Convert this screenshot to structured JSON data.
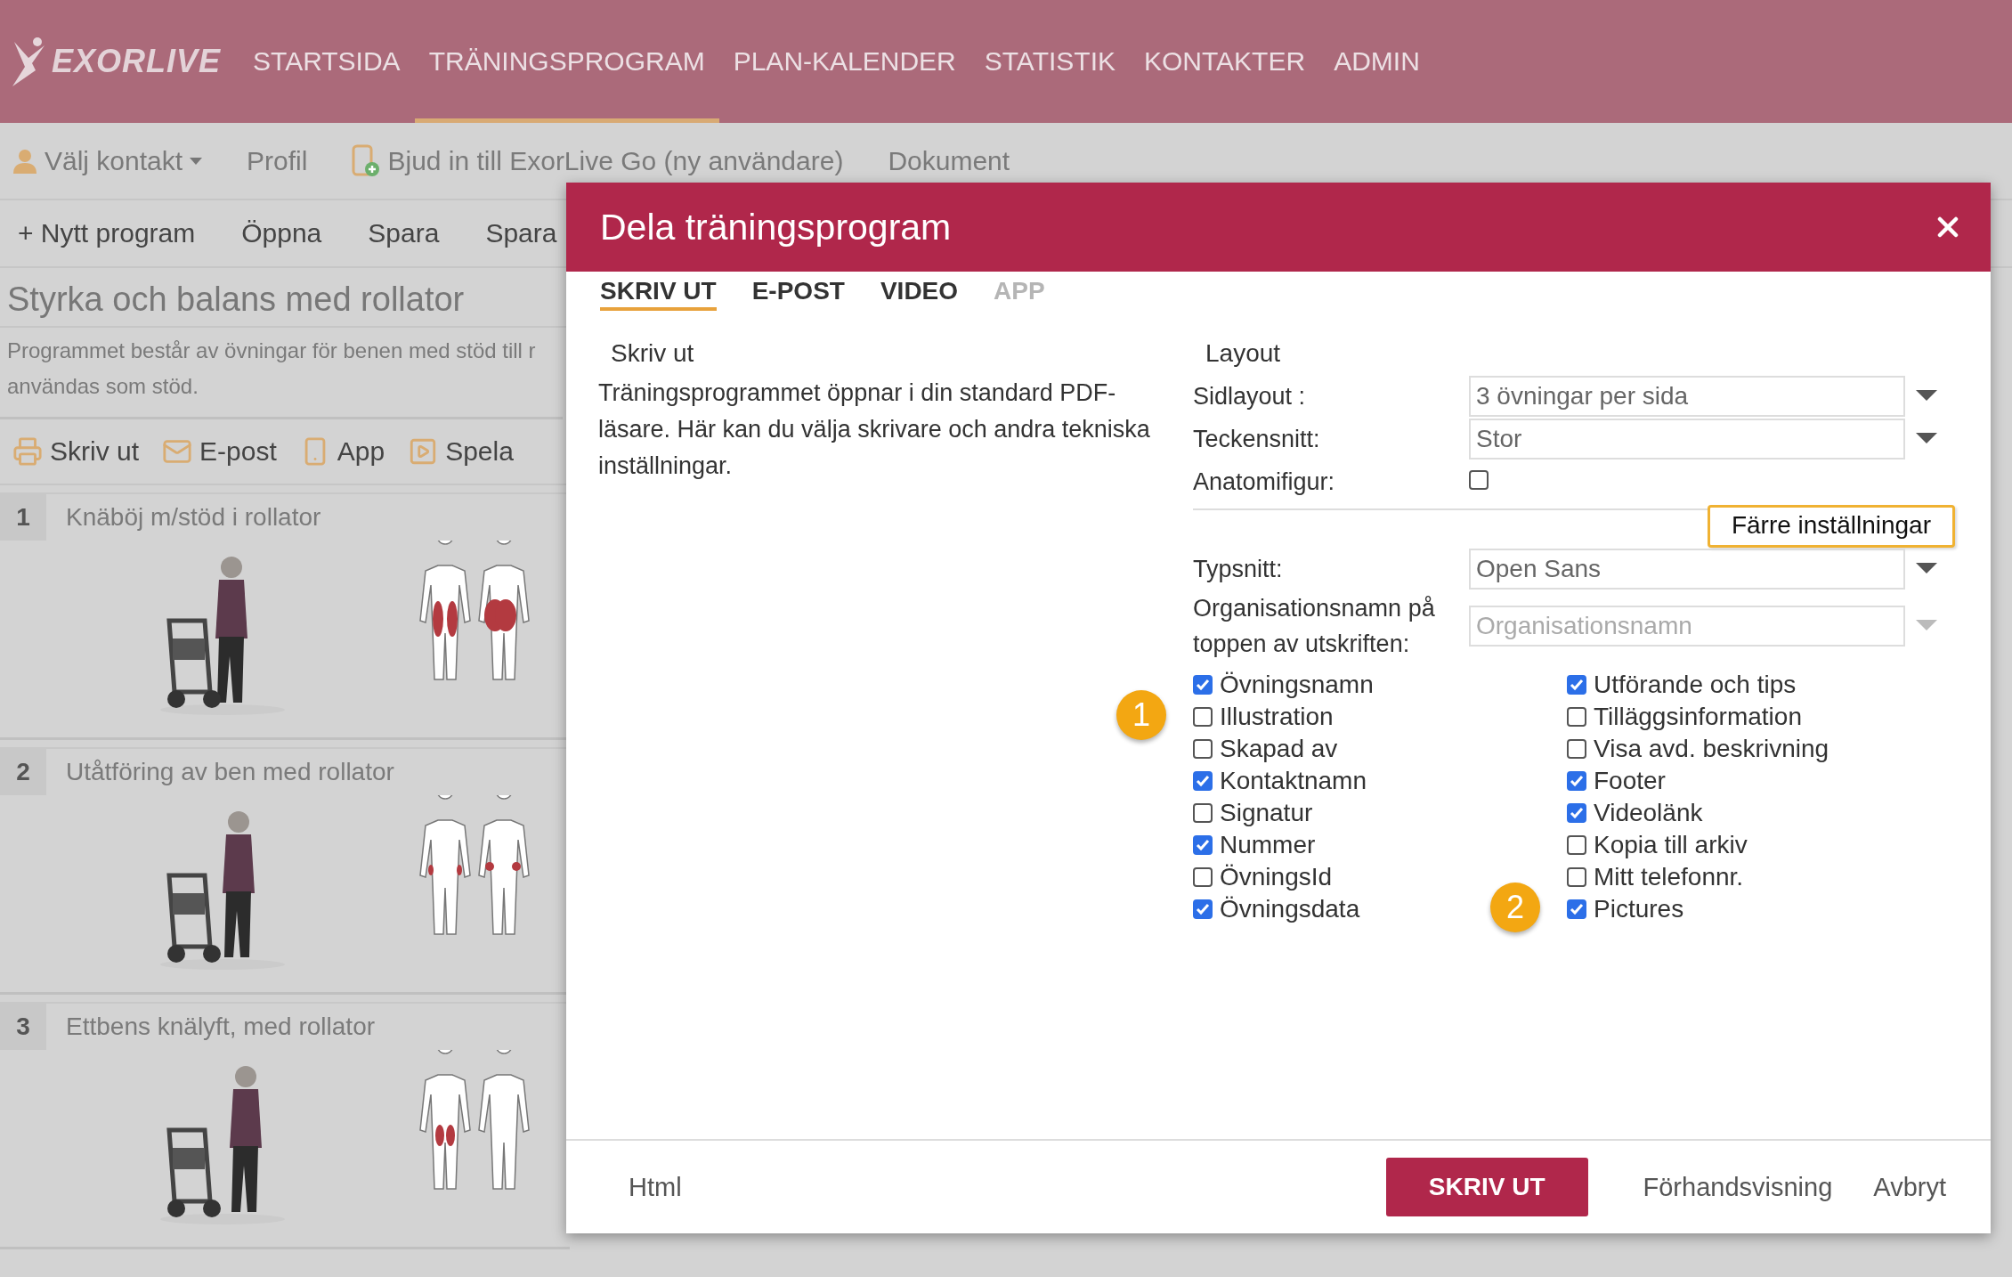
{
  "header": {
    "logo": "EXORLIVE",
    "nav": [
      {
        "label": "STARTSIDA",
        "selected": false
      },
      {
        "label": "TRÄNINGSPROGRAM",
        "selected": true
      },
      {
        "label": "PLAN-KALENDER",
        "selected": false
      },
      {
        "label": "STATISTIK",
        "selected": false
      },
      {
        "label": "KONTAKTER",
        "selected": false
      },
      {
        "label": "ADMIN",
        "selected": false
      }
    ]
  },
  "toolbar": [
    {
      "label": "Välj kontakt",
      "kind": "contact"
    },
    {
      "label": "Profil",
      "kind": "plain"
    },
    {
      "label": "Bjud in till ExorLive Go (ny användare)",
      "kind": "invite"
    },
    {
      "label": "Dokument",
      "kind": "plain"
    }
  ],
  "commands": [
    "+ Nytt program",
    "Öppna",
    "Spara",
    "Spara"
  ],
  "program": {
    "title": "Styrka och balans med rollator",
    "description": "Programmet består av övningar för benen med stöd till r användas som stöd."
  },
  "share_actions": [
    {
      "label": "Skriv ut",
      "kind": "print"
    },
    {
      "label": "E-post",
      "kind": "email"
    },
    {
      "label": "App",
      "kind": "phone"
    },
    {
      "label": "Spela",
      "kind": "play"
    }
  ],
  "exercises": [
    {
      "number": "1",
      "title": "Knäböj m/stöd i rollator"
    },
    {
      "number": "2",
      "title": "Utåtföring av ben med rollator"
    },
    {
      "number": "3",
      "title": "Ettbens knälyft, med rollator"
    }
  ],
  "dialog": {
    "title": "Dela träningsprogram",
    "tabs": [
      {
        "label": "SKRIV UT",
        "selected": true,
        "disabled": false
      },
      {
        "label": "E-POST",
        "selected": false,
        "disabled": false
      },
      {
        "label": "VIDEO",
        "selected": false,
        "disabled": false
      },
      {
        "label": "APP",
        "selected": false,
        "disabled": true
      }
    ],
    "intro": {
      "heading": "Skriv ut",
      "text": "Träningsprogrammet öppnar i din standard PDF-läsare. Här kan du välja skrivare och andra tekniska inställningar."
    },
    "layout": {
      "heading": "Layout",
      "fields": [
        {
          "label": "Sidlayout :",
          "kind": "select",
          "value": "3 övningar per sida",
          "disabled": false
        },
        {
          "label": "Teckensnitt:",
          "kind": "select",
          "value": "Stor",
          "disabled": false
        },
        {
          "label": "Anatomifigur:",
          "kind": "checkbox",
          "checked": false
        }
      ]
    },
    "toggle_button": "Färre inställningar",
    "more_fields": [
      {
        "label": "Typsnitt:",
        "kind": "select",
        "value": "Open Sans",
        "disabled": false
      },
      {
        "label": "Organisationsnamn på toppen av utskriften:",
        "kind": "select",
        "placeholder": "Organisationsnamn",
        "disabled": true
      }
    ],
    "options": [
      [
        {
          "label": "Övningsnamn",
          "checked": true
        },
        {
          "label": "Illustration",
          "checked": false,
          "callout": "1"
        },
        {
          "label": "Skapad av",
          "checked": false
        },
        {
          "label": "Kontaktnamn",
          "checked": true
        },
        {
          "label": "Signatur",
          "checked": false
        },
        {
          "label": "Nummer",
          "checked": true
        },
        {
          "label": "ÖvningsId",
          "checked": false
        },
        {
          "label": "Övningsdata",
          "checked": true
        }
      ],
      [
        {
          "label": "Utförande och tips",
          "checked": true
        },
        {
          "label": "Tilläggsinformation",
          "checked": false
        },
        {
          "label": "Visa avd. beskrivning",
          "checked": false
        },
        {
          "label": "Footer",
          "checked": true
        },
        {
          "label": "Videolänk",
          "checked": true
        },
        {
          "label": "Kopia till arkiv",
          "checked": false
        },
        {
          "label": "Mitt telefonnr.",
          "checked": false
        },
        {
          "label": "Pictures",
          "checked": true,
          "callout": "2"
        }
      ]
    ],
    "footer": {
      "link": "Html",
      "primary": "SKRIV UT",
      "buttons": [
        "Förhandsvisning",
        "Avbryt"
      ]
    }
  }
}
